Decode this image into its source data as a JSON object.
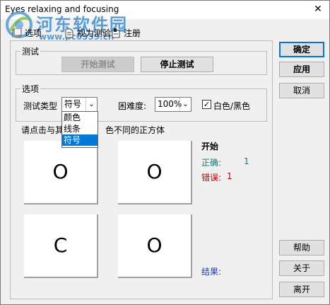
{
  "window": {
    "title": "Eyes relaxing and focusing",
    "close_glyph": "✕"
  },
  "watermark": {
    "site_name": "河东软件园",
    "url": "www.pc0359.cn"
  },
  "tabs": [
    {
      "label": "选项"
    },
    {
      "label": "视力测验"
    },
    {
      "label": "注册"
    }
  ],
  "test_group": {
    "legend": "测试",
    "start_button": "开始测试",
    "stop_button": "停止测试"
  },
  "options_group": {
    "legend": "选项",
    "test_type_label": "测试类型",
    "test_type_value": "符号",
    "difficulty_label": "困难度:",
    "difficulty_value": "100%",
    "bw_checkbox_label": "白色/黑色",
    "bw_checked": true,
    "dropdown_options": [
      "颜色",
      "线条",
      "符号"
    ],
    "dropdown_selected_index": 2
  },
  "game": {
    "instruction_left": "请点击与其",
    "instruction_right": "色不同的正方体",
    "squares": [
      "O",
      "O",
      "C",
      "O"
    ],
    "start_label": "开始",
    "correct_label": "正确:",
    "correct_value": "1",
    "wrong_label": "错误:",
    "wrong_value": "1",
    "result_label": "结果:",
    "colors": {
      "correct": "#008080",
      "wrong": "#c00000",
      "result": "#1f3ea8",
      "accent": "#0078d7"
    }
  },
  "side_buttons": {
    "ok": "确定",
    "apply": "应用",
    "cancel": "取消",
    "help": "帮助",
    "about": "关于",
    "exit": "离开"
  }
}
